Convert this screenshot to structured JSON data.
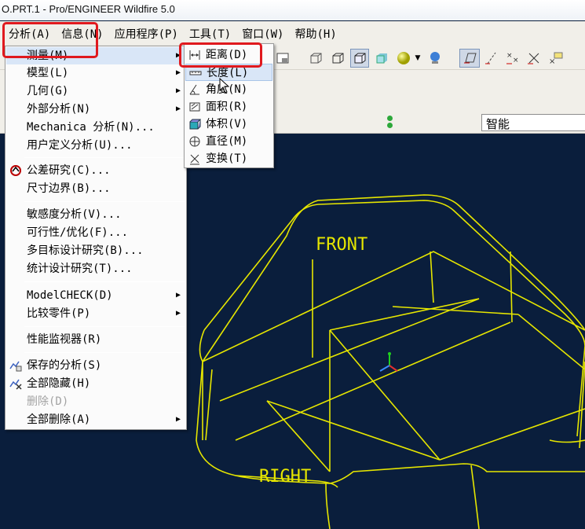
{
  "window": {
    "title": "O.PRT.1 - Pro/ENGINEER Wildfire 5.0"
  },
  "menubar": {
    "items": [
      "分析(A)",
      "信息(N)",
      "应用程序(P)",
      "工具(T)",
      "窗口(W)",
      "帮助(H)"
    ]
  },
  "analysis_menu": {
    "items": [
      {
        "label": "测量(M)",
        "submenu": true,
        "highlighted": true
      },
      {
        "label": "模型(L)",
        "submenu": true
      },
      {
        "label": "几何(G)",
        "submenu": true
      },
      {
        "label": "外部分析(N)",
        "submenu": true
      },
      {
        "label": "Mechanica 分析(N)..."
      },
      {
        "label": "用户定义分析(U)..."
      },
      {
        "label": "公差研究(C)...",
        "icon": "tolerance-icon"
      },
      {
        "label": "尺寸边界(B)..."
      },
      {
        "label": "敏感度分析(V)..."
      },
      {
        "label": "可行性/优化(F)..."
      },
      {
        "label": "多目标设计研究(B)..."
      },
      {
        "label": "统计设计研究(T)..."
      },
      {
        "label": "ModelCHECK(D)",
        "submenu": true
      },
      {
        "label": "比较零件(P)",
        "submenu": true
      },
      {
        "label": "性能监视器(R)"
      },
      {
        "label": "保存的分析(S)",
        "icon": "saved-analysis-icon"
      },
      {
        "label": "全部隐藏(H)",
        "icon": "hide-all-icon"
      },
      {
        "label": "删除(D)",
        "disabled": true
      },
      {
        "label": "全部删除(A)",
        "submenu": true
      }
    ]
  },
  "measure_submenu": {
    "items": [
      {
        "label": "距离(D)",
        "icon": "distance-icon"
      },
      {
        "label": "长度(L)",
        "icon": "length-icon",
        "highlighted": true
      },
      {
        "label": "角度(N)",
        "icon": "angle-icon"
      },
      {
        "label": "面积(R)",
        "icon": "area-icon"
      },
      {
        "label": "体积(V)",
        "icon": "volume-icon"
      },
      {
        "label": "直径(M)",
        "icon": "diameter-icon"
      },
      {
        "label": "变换(T)",
        "icon": "transform-icon"
      }
    ]
  },
  "filter": {
    "value": "智能"
  },
  "viewport": {
    "labels": {
      "front": "FRONT",
      "right": "RIGHT"
    },
    "background": "#0a1e3c",
    "wire_color": "#e6e600"
  },
  "colors": {
    "highlight_box": "#e0191e",
    "menu_highlight": "#d9e6f7"
  }
}
